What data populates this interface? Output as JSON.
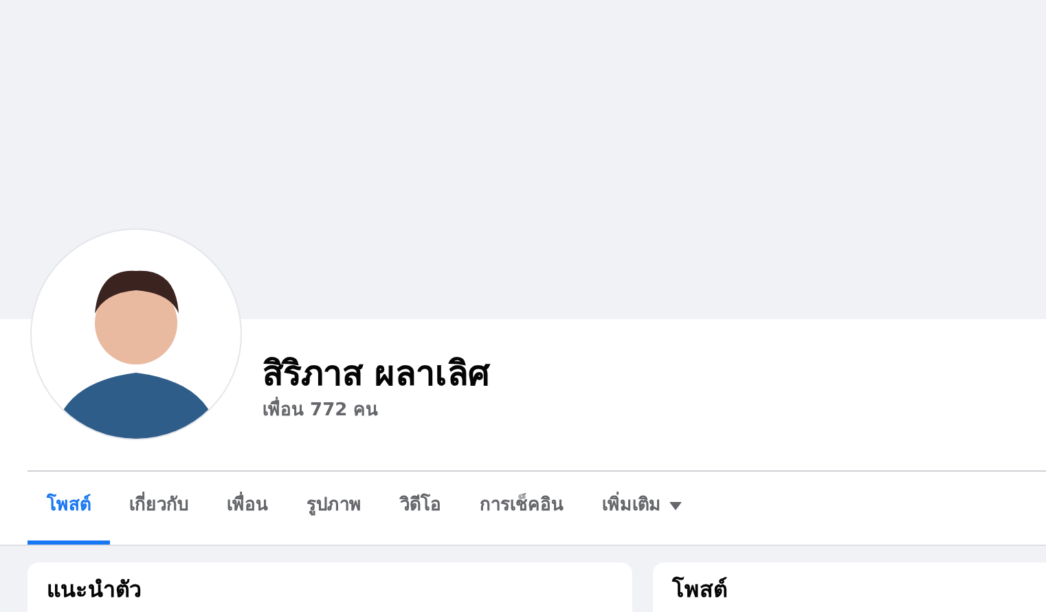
{
  "profile": {
    "name": "สิริภาส ผลาเลิศ",
    "friends": "เพื่อน 772 คน"
  },
  "tabs": [
    {
      "label": "โพสต์",
      "selected": true,
      "kind": "tab"
    },
    {
      "label": "เกี่ยวกับ",
      "selected": false,
      "kind": "tab"
    },
    {
      "label": "เพื่อน",
      "selected": false,
      "kind": "tab"
    },
    {
      "label": "รูปภาพ",
      "selected": false,
      "kind": "tab"
    },
    {
      "label": "วิดีโอ",
      "selected": false,
      "kind": "tab"
    },
    {
      "label": "การเช็คอิน",
      "selected": false,
      "kind": "tab"
    },
    {
      "label": "เพิ่มเติม",
      "selected": false,
      "kind": "dropdown"
    }
  ],
  "cards": [
    {
      "title": "แนะนำตัว"
    },
    {
      "title": "โพสต์"
    }
  ]
}
